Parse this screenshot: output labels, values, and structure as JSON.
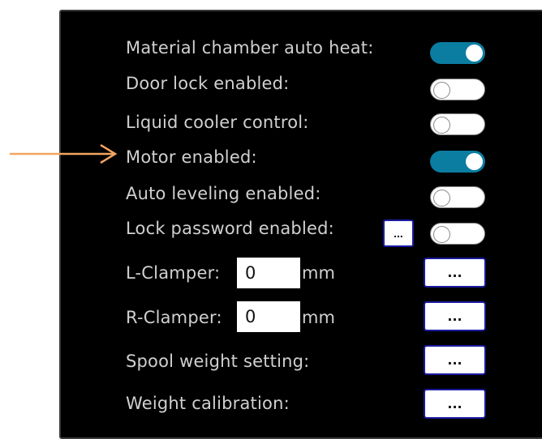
{
  "settings": {
    "toggles": [
      {
        "label": "Material chamber auto heat:",
        "on": true
      },
      {
        "label": "Door lock enabled:",
        "on": false
      },
      {
        "label": "Liquid cooler control:",
        "on": false
      },
      {
        "label": "Motor enabled:",
        "on": true
      },
      {
        "label": "Auto leveling enabled:",
        "on": false
      },
      {
        "label": "Lock password enabled:",
        "on": false
      }
    ],
    "password_button_label": "...",
    "l_clamper": {
      "label": "L-Clamper:",
      "value": "0",
      "unit": "mm",
      "button_label": "..."
    },
    "r_clamper": {
      "label": "R-Clamper:",
      "value": "0",
      "unit": "mm",
      "button_label": "..."
    },
    "spool_weight": {
      "label": "Spool weight setting:",
      "button_label": "..."
    },
    "weight_calibration": {
      "label": "Weight calibration:",
      "button_label": "..."
    }
  },
  "colors": {
    "toggle_on": "#0b7da0",
    "arrow": "#f4a460",
    "panel_bg": "#000000"
  },
  "annotation": {
    "icon": "arrow-right-icon"
  }
}
